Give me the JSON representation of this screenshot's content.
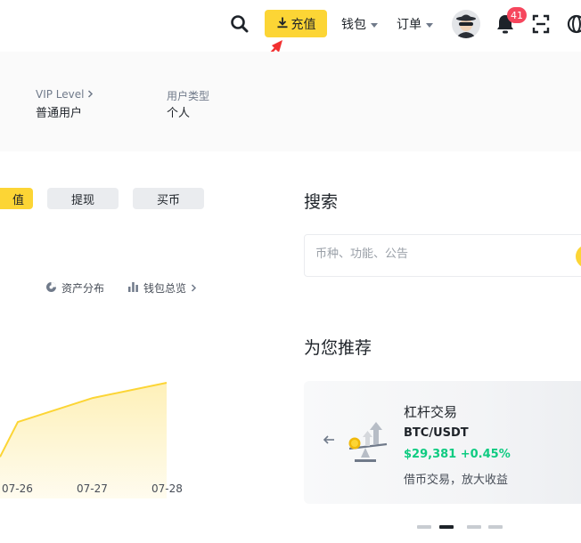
{
  "header": {
    "deposit_label": "充值",
    "wallet_label": "钱包",
    "orders_label": "订单",
    "notification_count": "41",
    "icons": [
      "search-icon",
      "download-icon",
      "avatar",
      "bell-icon",
      "scan-icon",
      "globe-icon"
    ]
  },
  "profile": {
    "vip_label": "VIP Level",
    "vip_value": "普通用户",
    "type_label": "用户类型",
    "type_value": "个人"
  },
  "actions": {
    "deposit": "值",
    "withdraw": "提现",
    "buy": "买币"
  },
  "links": {
    "distribution": "资产分布",
    "overview": "钱包总览"
  },
  "chart_data": {
    "type": "area",
    "x": [
      "07-26",
      "07-27",
      "07-28"
    ],
    "series": [
      {
        "values": [
          0.82,
          0.93,
          1.0
        ]
      }
    ],
    "color": "#fcd535"
  },
  "search": {
    "title": "搜索",
    "placeholder": "币种、功能、公告"
  },
  "recommend": {
    "title": "为您推荐",
    "card": {
      "name": "杠杆交易",
      "pair": "BTC/USDT",
      "price": "$29,381 +0.45%",
      "desc": "借币交易，放大收益"
    }
  },
  "colors": {
    "brand": "#fcd535",
    "positive": "#0ecb81",
    "badge": "#f6465d",
    "annotation_arrow": "#f23030"
  }
}
